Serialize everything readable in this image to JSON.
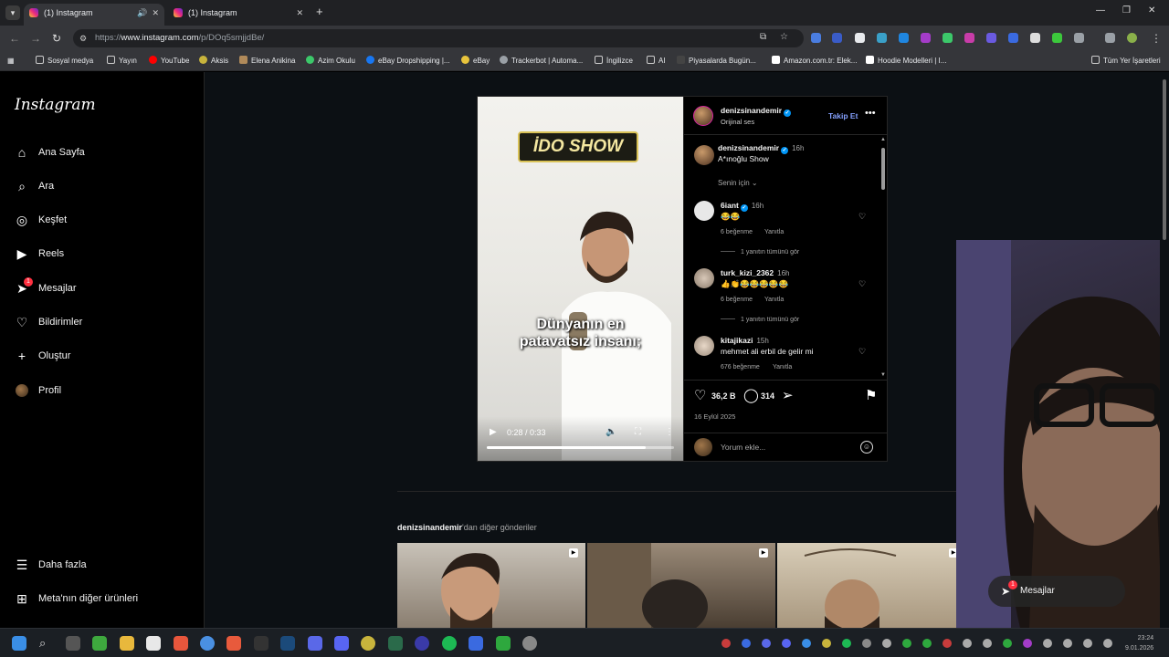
{
  "browser": {
    "tabs": [
      {
        "label": "(1) Instagram",
        "active": true
      },
      {
        "label": "(1) Instagram",
        "active": false
      }
    ],
    "url_prefix": "https://",
    "url_host": "www.instagram.com",
    "url_path": "/p/DOq5smjjdBe/",
    "bookmarks": [
      "Sosyal medya",
      "Yayın",
      "YouTube",
      "Aksis",
      "Elena Anikina",
      "Azim Okulu",
      "eBay Dropshipping |...",
      "eBay",
      "Trackerbot | Automa...",
      "İngilizce",
      "AI",
      "Piyasalarda Bugün...",
      "Amazon.com.tr: Elek...",
      "Hoodie Modelleri | I...",
      "Tüm Yer İşaretleri"
    ]
  },
  "sidebar": {
    "logo": "Instagram",
    "items": [
      {
        "label": "Ana Sayfa"
      },
      {
        "label": "Ara"
      },
      {
        "label": "Keşfet"
      },
      {
        "label": "Reels"
      },
      {
        "label": "Mesajlar",
        "badge": "1"
      },
      {
        "label": "Bildirimler"
      },
      {
        "label": "Oluştur"
      },
      {
        "label": "Profil"
      }
    ],
    "bottom": [
      {
        "label": "Daha fazla"
      },
      {
        "label": "Meta'nın diğer ürünleri"
      }
    ]
  },
  "post": {
    "video": {
      "title_overlay": "İDO SHOW",
      "caption_line1": "Dünyanın en",
      "caption_line2": "patavatsız insanı;",
      "time": "0:28 / 0:33",
      "progress": 0.85
    },
    "author": {
      "username": "denizsinandemir",
      "audio": "Orijinal ses",
      "follow": "Takip Et"
    },
    "caption": {
      "username": "denizsinandemir",
      "time": "16h",
      "text": "A*ınoğlu Show"
    },
    "sort_label": "Senin için",
    "comments": [
      {
        "username": "6iant",
        "time": "16h",
        "text": "😂😂",
        "likes": "6 beğenme",
        "reply": "Yanıtla",
        "replies": "1 yanıtın tümünü gör"
      },
      {
        "username": "turk_kizi_2362",
        "time": "16h",
        "text": "👍👏😂😂😂😂😂",
        "likes": "6 beğenme",
        "reply": "Yanıtla",
        "replies": "1 yanıtın tümünü gör"
      },
      {
        "username": "kitajikazi",
        "time": "15h",
        "text": "mehmet ali erbil de gelir mi",
        "likes": "676 beğenme",
        "reply": "Yanıtla"
      }
    ],
    "like_count": "36,2 B",
    "comment_count": "314",
    "date": "16 Eylül 2025",
    "comment_placeholder": "Yorum ekle..."
  },
  "more_posts": {
    "username": "denizsinandemir",
    "suffix": "'dan diğer gönderiler"
  },
  "messages_pill": {
    "label": "Mesajlar",
    "badge": "1"
  },
  "clock": {
    "time": "23:24",
    "date": "9.01.2026"
  }
}
